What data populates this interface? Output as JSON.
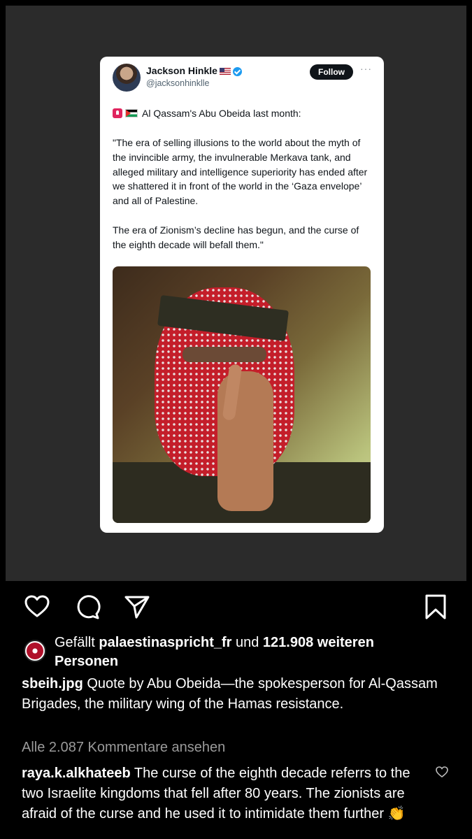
{
  "tweet": {
    "name": "Jackson Hinkle",
    "handle": "@jacksonhinklle",
    "follow_label": "Follow",
    "more_label": "···",
    "headline": "Al Qassam's Abu Obeida last month:",
    "quote": "\"The era of selling illusions to the world about the myth of the invincible army, the invulnerable Merkava tank, and alleged military and intelligence superiority has ended after we shattered it in front of the world in the ‘Gaza envelope’ and all of Palestine.\n\nThe era of Zionism’s decline has begun, and the curse of the eighth decade will befall them.\""
  },
  "actions": {
    "like_icon": "heart-icon",
    "comment_icon": "comment-icon",
    "share_icon": "share-icon",
    "save_icon": "bookmark-icon"
  },
  "likes": {
    "prefix": "Gefällt ",
    "user": "palaestinaspricht_fr",
    "middle": " und ",
    "count": "121.908 weiteren",
    "suffix": "Personen"
  },
  "caption": {
    "user": "sbeih.jpg",
    "text": " Quote by Abu Obeida—the spokesperson for Al-Qassam Brigades, the military wing of the Hamas resistance."
  },
  "view_comments": "Alle 2.087 Kommentare ansehen",
  "comment": {
    "user": "raya.k.alkhateeb",
    "text": " The curse of the eighth decade referrs to the two Israelite kingdoms that fell after 80 years. The zionists are afraid of the curse and he used it to intimidate them further 👏"
  },
  "colors": {
    "background": "#000000",
    "media_bg": "#2b2b2b",
    "follow_bg": "#0f1419",
    "verified": "#1d9bf0",
    "muted": "#9a9a9a"
  }
}
